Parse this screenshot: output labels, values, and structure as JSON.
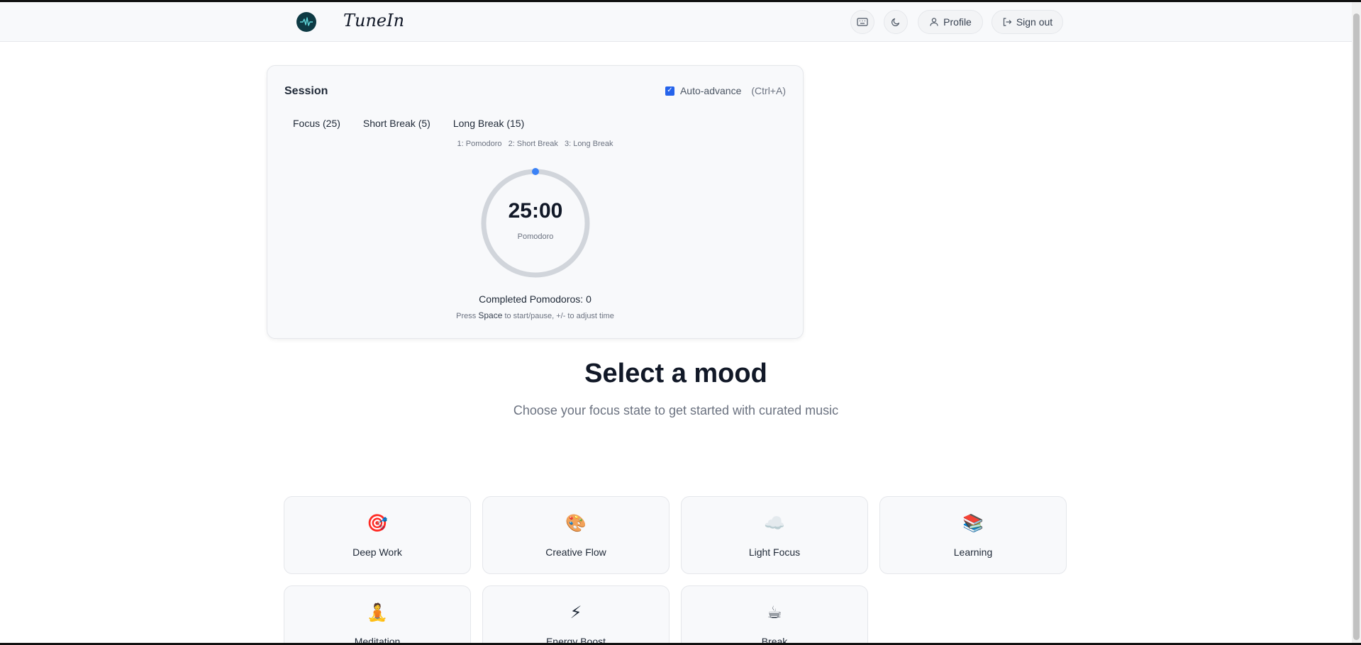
{
  "header": {
    "brand": "TuneIn",
    "buttons": {
      "keyboard_icon": "keyboard-icon",
      "theme_icon": "moon-icon",
      "profile_label": "Profile",
      "signout_label": "Sign out"
    }
  },
  "session": {
    "title": "Session",
    "auto_advance": {
      "checked": true,
      "label": "Auto-advance",
      "shortcut": "(Ctrl+A)"
    },
    "tabs": [
      {
        "label": "Focus (25)"
      },
      {
        "label": "Short Break (5)"
      },
      {
        "label": "Long Break (15)"
      }
    ],
    "hints": [
      "1: Pomodoro",
      "2: Short Break",
      "3: Long Break"
    ],
    "timer": {
      "time": "25:00",
      "mode": "Pomodoro",
      "progress": 0
    },
    "completed": "Completed Pomodoros: 0",
    "shortcut_text": {
      "prefix": "Press ",
      "key": "Space",
      "suffix": " to start/pause, +/- to adjust time"
    }
  },
  "moods": {
    "title": "Select a mood",
    "subtitle": "Choose your focus state to get started with curated music",
    "items": [
      {
        "emoji": "🎯",
        "label": "Deep Work"
      },
      {
        "emoji": "🎨",
        "label": "Creative Flow"
      },
      {
        "emoji": "☁️",
        "label": "Light Focus"
      },
      {
        "emoji": "📚",
        "label": "Learning"
      },
      {
        "emoji": "🧘",
        "label": "Meditation"
      },
      {
        "emoji": "⚡",
        "label": "Energy Boost"
      },
      {
        "emoji": "☕",
        "label": "Break"
      }
    ]
  },
  "colors": {
    "accent": "#3b82f6",
    "ring": "#d1d5db",
    "logo_bg": "#0e3a44"
  }
}
